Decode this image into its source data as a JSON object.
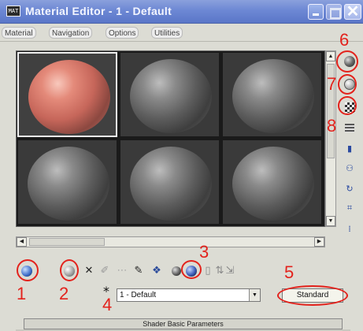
{
  "window": {
    "title": "Material Editor - 1 - Default",
    "app_icon_text": "MAT"
  },
  "menu": {
    "items": [
      "Material",
      "Navigation",
      "Options",
      "Utilities"
    ]
  },
  "slots": {
    "materials": [
      "red",
      "grey",
      "grey",
      "grey",
      "grey",
      "grey"
    ],
    "active_index": 0
  },
  "toolbar": {
    "material_name": "1 - Default",
    "material_type": "Standard",
    "pick_icon_text": "*"
  },
  "rollout": {
    "title": "Shader Basic Parameters"
  },
  "annotations": {
    "labels": [
      "1",
      "2",
      "3",
      "4",
      "5",
      "6",
      "7",
      "8"
    ],
    "color": "#e3221c"
  },
  "colors": {
    "title_bar": "#6d88d4",
    "annotation": "#e3221c",
    "active_material": "#c6665a"
  }
}
